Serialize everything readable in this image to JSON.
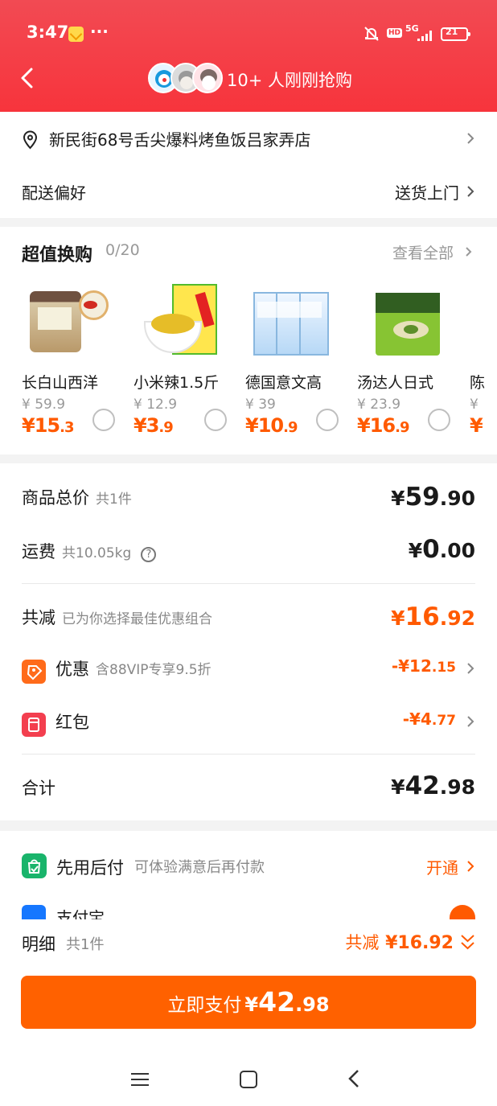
{
  "status_bar": {
    "time": "3:47",
    "more": "···",
    "hd": "HD",
    "network": "5G",
    "battery": "21"
  },
  "header": {
    "buyers_text": "10+ 人刚刚抢购"
  },
  "address": {
    "text": "新民街68号舌尖爆料烤鱼饭吕家弄店"
  },
  "delivery": {
    "label": "配送偏好",
    "value": "送货上门"
  },
  "exchange": {
    "title": "超值换购",
    "count": "0/20",
    "view_all": "查看全部"
  },
  "products": [
    {
      "name": "长白山西洋",
      "old_price": "¥ 59.9",
      "price_main": "¥15",
      "price_cents": ".3"
    },
    {
      "name": "小米辣1.5斤",
      "old_price": "¥ 12.9",
      "price_main": "¥3",
      "price_cents": ".9"
    },
    {
      "name": "德国意文高",
      "old_price": "¥ 39",
      "price_main": "¥10",
      "price_cents": ".9"
    },
    {
      "name": "汤达人日式",
      "old_price": "¥ 23.9",
      "price_main": "¥16",
      "price_cents": ".9"
    },
    {
      "name": "陈",
      "old_price": "¥",
      "price_main": "¥",
      "price_cents": ""
    }
  ],
  "summary": {
    "total": {
      "label": "商品总价",
      "sub": "共1件",
      "currency": "¥",
      "main": "59",
      "cents": ".90"
    },
    "shipping": {
      "label": "运费",
      "sub": "共10.05kg",
      "currency": "¥",
      "main": "0",
      "cents": ".00"
    },
    "reduction": {
      "label": "共减",
      "sub": "已为你选择最佳优惠组合",
      "currency": "¥",
      "main": "16",
      "cents": ".92"
    },
    "discount": {
      "label": "优惠",
      "sub": "含88VIP专享9.5折",
      "amount_main": "-¥12",
      "amount_cents": ".15"
    },
    "red_packet": {
      "label": "红包",
      "amount_main": "-¥4",
      "amount_cents": ".77"
    },
    "grand_total": {
      "label": "合计",
      "currency": "¥",
      "main": "42",
      "cents": ".98"
    }
  },
  "payment": {
    "later_title": "先用后付",
    "later_desc": "可体验满意后再付款",
    "activate": "开通",
    "alipay": "支付宝"
  },
  "bottom": {
    "detail_title": "明细",
    "detail_count": "共1件",
    "discount_prefix": "共减",
    "discount_value": "¥16.92",
    "button_label": "立即支付",
    "button_currency": "¥",
    "button_main": "42",
    "button_cents": ".98"
  },
  "colors": {
    "header": "#f53a42",
    "accent": "#ff5a00",
    "pay_button": "#ff6100",
    "green": "#19b46b",
    "blue": "#1677ff"
  },
  "icons": [
    "back-arrow-icon",
    "mute-bell-icon",
    "signal-icon",
    "battery-icon",
    "location-pin-icon",
    "chevron-right-icon",
    "question-mark-icon",
    "discount-tag-icon",
    "red-packet-icon",
    "payment-later-icon",
    "alipay-icon",
    "double-chevron-down-icon",
    "menu-icon",
    "home-icon",
    "back-nav-icon"
  ]
}
